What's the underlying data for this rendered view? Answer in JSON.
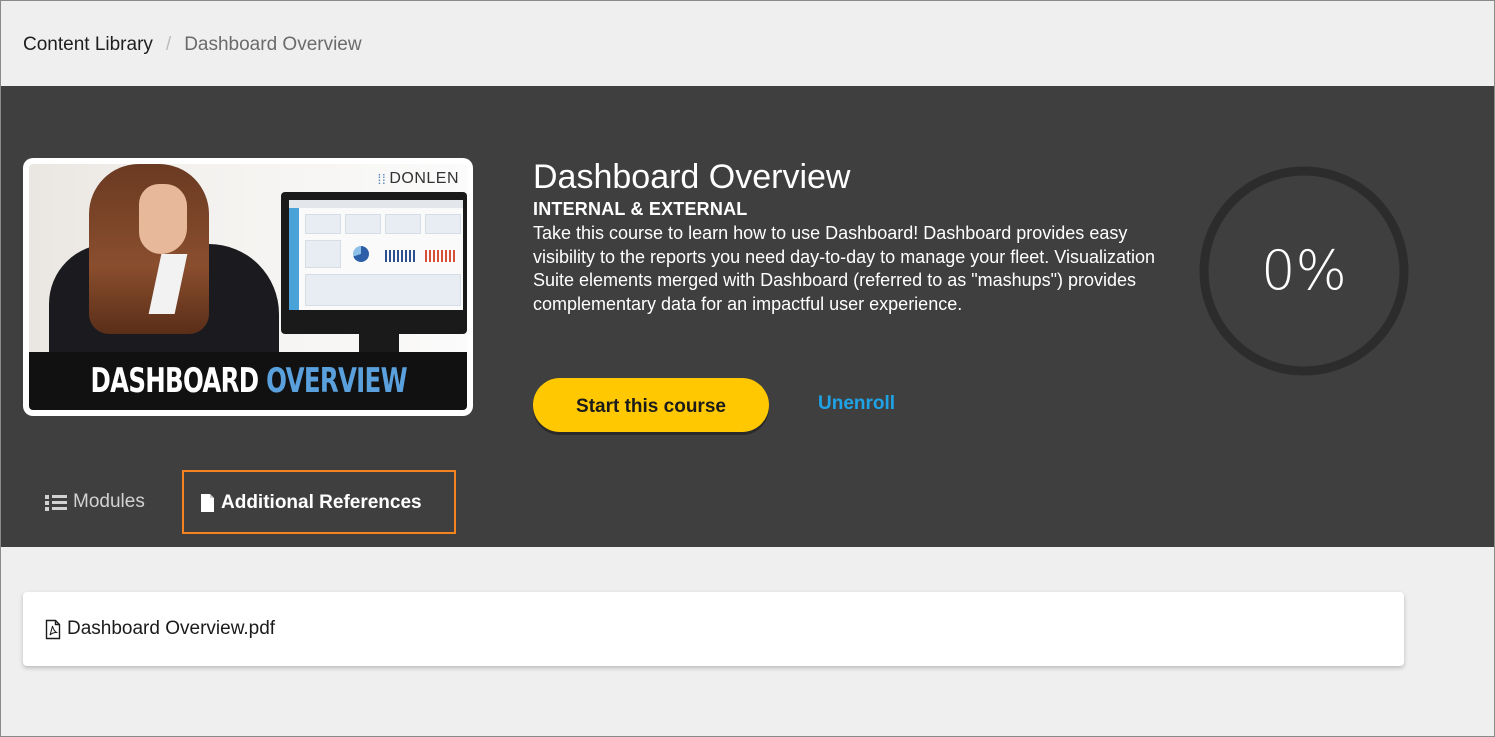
{
  "breadcrumb": {
    "root": "Content Library",
    "separator": "/",
    "current": "Dashboard Overview"
  },
  "course": {
    "thumbnail": {
      "logo_text": "DONLEN",
      "banner_word1": "DASHBOARD",
      "banner_word2": "OVERVIEW"
    },
    "title": "Dashboard Overview",
    "audience": "INTERNAL & EXTERNAL",
    "description": "Take this course to learn how to use Dashboard! Dashboard provides easy visibility to the reports you need day-to-day to manage your fleet. Visualization Suite elements merged with Dashboard (referred to as \"mashups\") provides complementary data for an impactful user experience.",
    "start_label": "Start this course",
    "unenroll_label": "Unenroll",
    "progress_text": "0%",
    "progress_value": 0
  },
  "tabs": [
    {
      "label": "Modules",
      "icon": "list-icon",
      "active": false
    },
    {
      "label": "Additional References",
      "icon": "file-icon",
      "active": true
    }
  ],
  "references": [
    {
      "name": "Dashboard Overview.pdf",
      "icon": "pdf-file-icon"
    }
  ],
  "colors": {
    "hero_bg": "#3f3f3f",
    "accent_yellow": "#ffc800",
    "link_blue": "#1fa3e6",
    "highlight_orange": "#f4821f",
    "page_bg": "#efeff0"
  }
}
